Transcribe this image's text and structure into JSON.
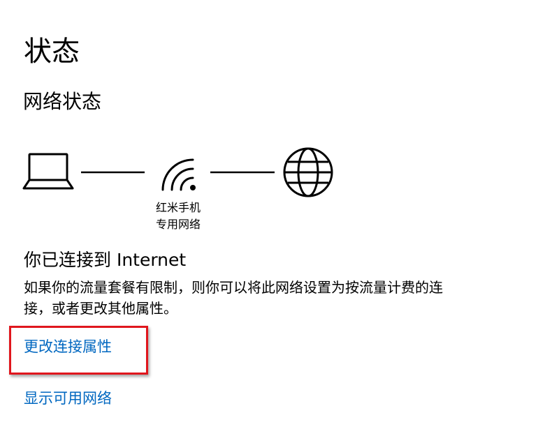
{
  "page": {
    "title": "状态"
  },
  "network_status": {
    "heading": "网络状态",
    "diagram": {
      "icons": [
        "laptop-icon",
        "wifi-icon",
        "globe-icon"
      ],
      "network_name_line1": "红米手机",
      "network_name_line2": "专用网络"
    },
    "connection_status": "你已连接到 Internet",
    "description": "如果你的流量套餐有限制，则你可以将此网络设置为按流量计费的连接，或者更改其他属性。"
  },
  "links": {
    "change_properties": "更改连接属性",
    "show_available": "显示可用网络"
  },
  "colors": {
    "link": "#0067c0",
    "highlight": "#e0161d"
  }
}
